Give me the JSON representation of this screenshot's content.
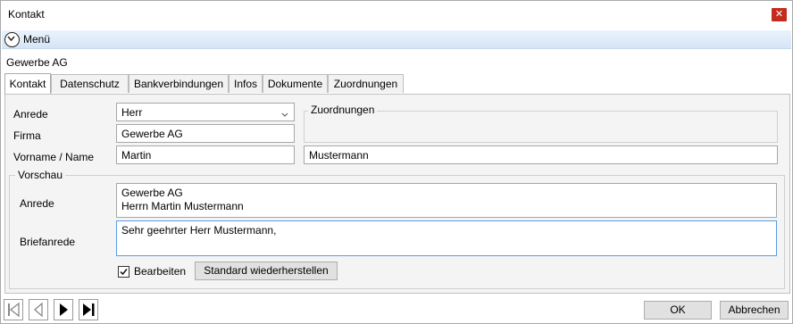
{
  "window": {
    "title": "Kontakt"
  },
  "menu": {
    "label": "Menü"
  },
  "company": "Gewerbe AG",
  "tabs": [
    {
      "label": "Kontakt"
    },
    {
      "label": "Datenschutz"
    },
    {
      "label": "Bankverbindungen"
    },
    {
      "label": "Infos"
    },
    {
      "label": "Dokumente"
    },
    {
      "label": "Zuordnungen"
    }
  ],
  "form": {
    "anrede_label": "Anrede",
    "anrede_value": "Herr",
    "firma_label": "Firma",
    "firma_value": "Gewerbe AG",
    "name_label": "Vorname / Name",
    "vorname_value": "Martin",
    "nachname_value": "Mustermann",
    "zuordnungen_title": "Zuordnungen"
  },
  "preview": {
    "title": "Vorschau",
    "anrede_label": "Anrede",
    "anrede_line1": "Gewerbe AG",
    "anrede_line2": "Herrn Martin Mustermann",
    "briefanrede_label": "Briefanrede",
    "briefanrede_value": "Sehr geehrter Herr Mustermann,",
    "edit_label": "Bearbeiten",
    "edit_checked": true,
    "reset_label": "Standard wiederherstellen"
  },
  "footer": {
    "ok_label": "OK",
    "cancel_label": "Abbrechen"
  },
  "colors": {
    "close": "#c42b1c",
    "menubar": "#dbe8f6",
    "focus": "#569de5"
  }
}
